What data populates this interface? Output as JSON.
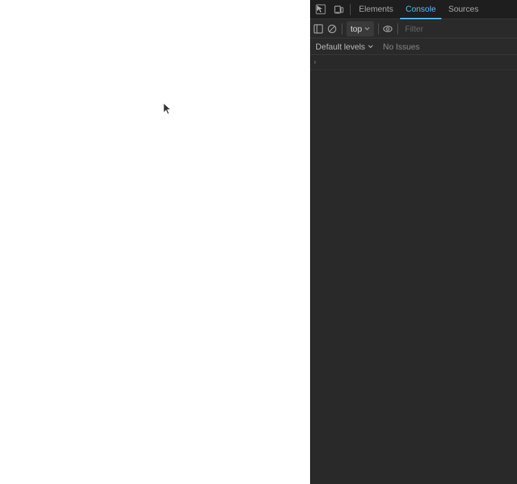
{
  "page": {
    "background": "#ffffff"
  },
  "devtools": {
    "tabs": [
      {
        "id": "elements",
        "label": "Elements",
        "active": false
      },
      {
        "id": "console",
        "label": "Console",
        "active": true
      },
      {
        "id": "sources",
        "label": "Sources",
        "active": false
      }
    ],
    "toolbar": {
      "clear_label": "🚫",
      "top_label": "top",
      "filter_placeholder": "Filter",
      "eye_label": "👁"
    },
    "levels": {
      "default_levels_label": "Default levels",
      "no_issues_label": "No Issues"
    },
    "console_rows": [
      {
        "id": "row1",
        "content": ">"
      }
    ]
  },
  "icons": {
    "inspect": "⬚",
    "device": "▭",
    "ban": "⊘",
    "eye": "◉",
    "chevron_right": "›",
    "triangle_down": "▾",
    "sidebar": "⊟",
    "cursor": "⌖"
  }
}
